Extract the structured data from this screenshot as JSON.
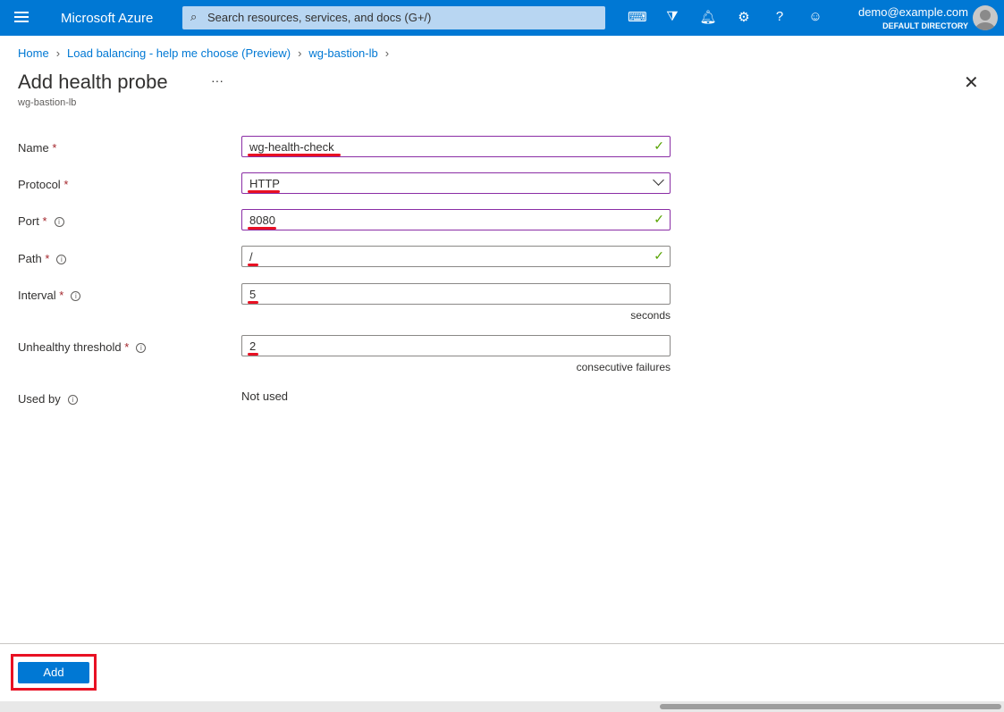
{
  "topbar": {
    "brand": "Microsoft Azure",
    "search_placeholder": "Search resources, services, and docs (G+/)",
    "user": "demo@example.com",
    "directory": "DEFAULT DIRECTORY",
    "icons": [
      "cloud-shell-icon",
      "directory-filter-icon",
      "bell-icon",
      "gear-icon",
      "help-icon",
      "feedback-icon"
    ]
  },
  "breadcrumb": [
    "Home",
    "Load balancing - help me choose (Preview)",
    "wg-bastion-lb"
  ],
  "page": {
    "title": "Add health probe",
    "more": "···",
    "subtitle": "wg-bastion-lb",
    "close": "✕"
  },
  "form": {
    "name": {
      "label": "Name",
      "value": "wg-health-check"
    },
    "protocol": {
      "label": "Protocol",
      "value": "HTTP"
    },
    "port": {
      "label": "Port",
      "value": "8080"
    },
    "path": {
      "label": "Path",
      "value": "/"
    },
    "interval": {
      "label": "Interval",
      "value": "5",
      "unit": "seconds"
    },
    "threshold": {
      "label": "Unhealthy threshold",
      "value": "2",
      "unit": "consecutive failures"
    },
    "used_by": {
      "label": "Used by",
      "value": "Not used"
    },
    "required": "*",
    "info": "i",
    "check": "✓"
  },
  "footer": {
    "add_label": "Add"
  }
}
